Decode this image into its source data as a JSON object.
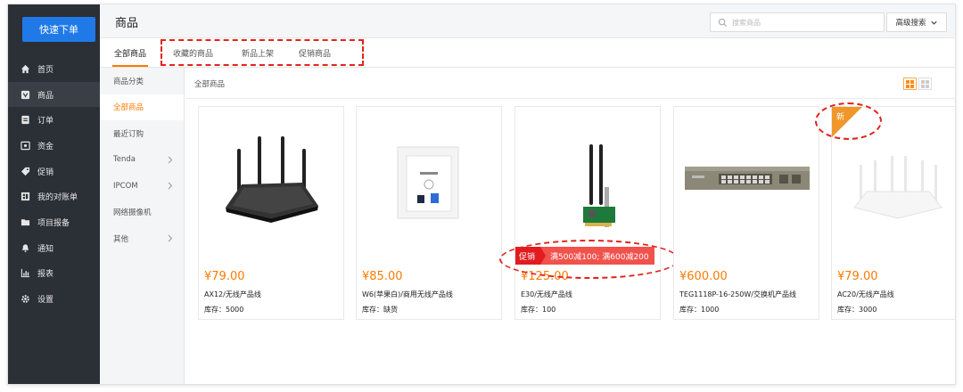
{
  "sidebar": {
    "quick_order": "快速下单",
    "items": [
      {
        "label": "首页",
        "icon": "home-icon"
      },
      {
        "label": "商品",
        "icon": "product-icon"
      },
      {
        "label": "订单",
        "icon": "order-icon"
      },
      {
        "label": "资金",
        "icon": "fund-icon"
      },
      {
        "label": "促销",
        "icon": "tag-icon"
      },
      {
        "label": "我的对账单",
        "icon": "statement-icon"
      },
      {
        "label": "项目报备",
        "icon": "folder-icon"
      },
      {
        "label": "通知",
        "icon": "bell-icon"
      },
      {
        "label": "报表",
        "icon": "chart-icon"
      },
      {
        "label": "设置",
        "icon": "gear-icon"
      }
    ]
  },
  "header": {
    "title": "商品",
    "search_placeholder": "搜索商品",
    "advanced_search": "高级搜索"
  },
  "tabs": [
    "全部商品",
    "收藏的商品",
    "新品上架",
    "促销商品"
  ],
  "categories": [
    {
      "label": "商品分类",
      "arrow": false
    },
    {
      "label": "全部商品",
      "arrow": false
    },
    {
      "label": "最近订购",
      "arrow": false
    },
    {
      "label": "Tenda",
      "arrow": true
    },
    {
      "label": "IPCOM",
      "arrow": true
    },
    {
      "label": "网络摄像机",
      "arrow": false
    },
    {
      "label": "其他",
      "arrow": true
    }
  ],
  "breadcrumb": "全部商品",
  "products": [
    {
      "price": "¥79.00",
      "name": "AX12/无线产品线",
      "stock": "库存：5000",
      "image": "wifi-router-icon"
    },
    {
      "price": "¥85.00",
      "name": "W6(苹果白)/商用无线产品线",
      "stock": "库存：缺货",
      "image": "wall-ap-icon"
    },
    {
      "price": "¥125.00",
      "name": "E30/无线产品线",
      "stock": "库存：100",
      "image": "pcie-card-icon",
      "promo": {
        "tag": "促销",
        "text": "满500减100; 满600减200"
      }
    },
    {
      "price": "¥600.00",
      "name": "TEG1118P-16-250W/交换机产品线",
      "stock": "库存：1000",
      "image": "switch-icon"
    },
    {
      "price": "¥79.00",
      "name": "AC20/无线产品线",
      "stock": "库存：3000",
      "image": "white-router-icon",
      "badge": "新"
    }
  ],
  "colors": {
    "accent": "#ff7a00",
    "primary": "#1f7ae8",
    "sidebar": "#2b2f36",
    "promo": "#e01c20",
    "annotation": "#e0241b"
  }
}
